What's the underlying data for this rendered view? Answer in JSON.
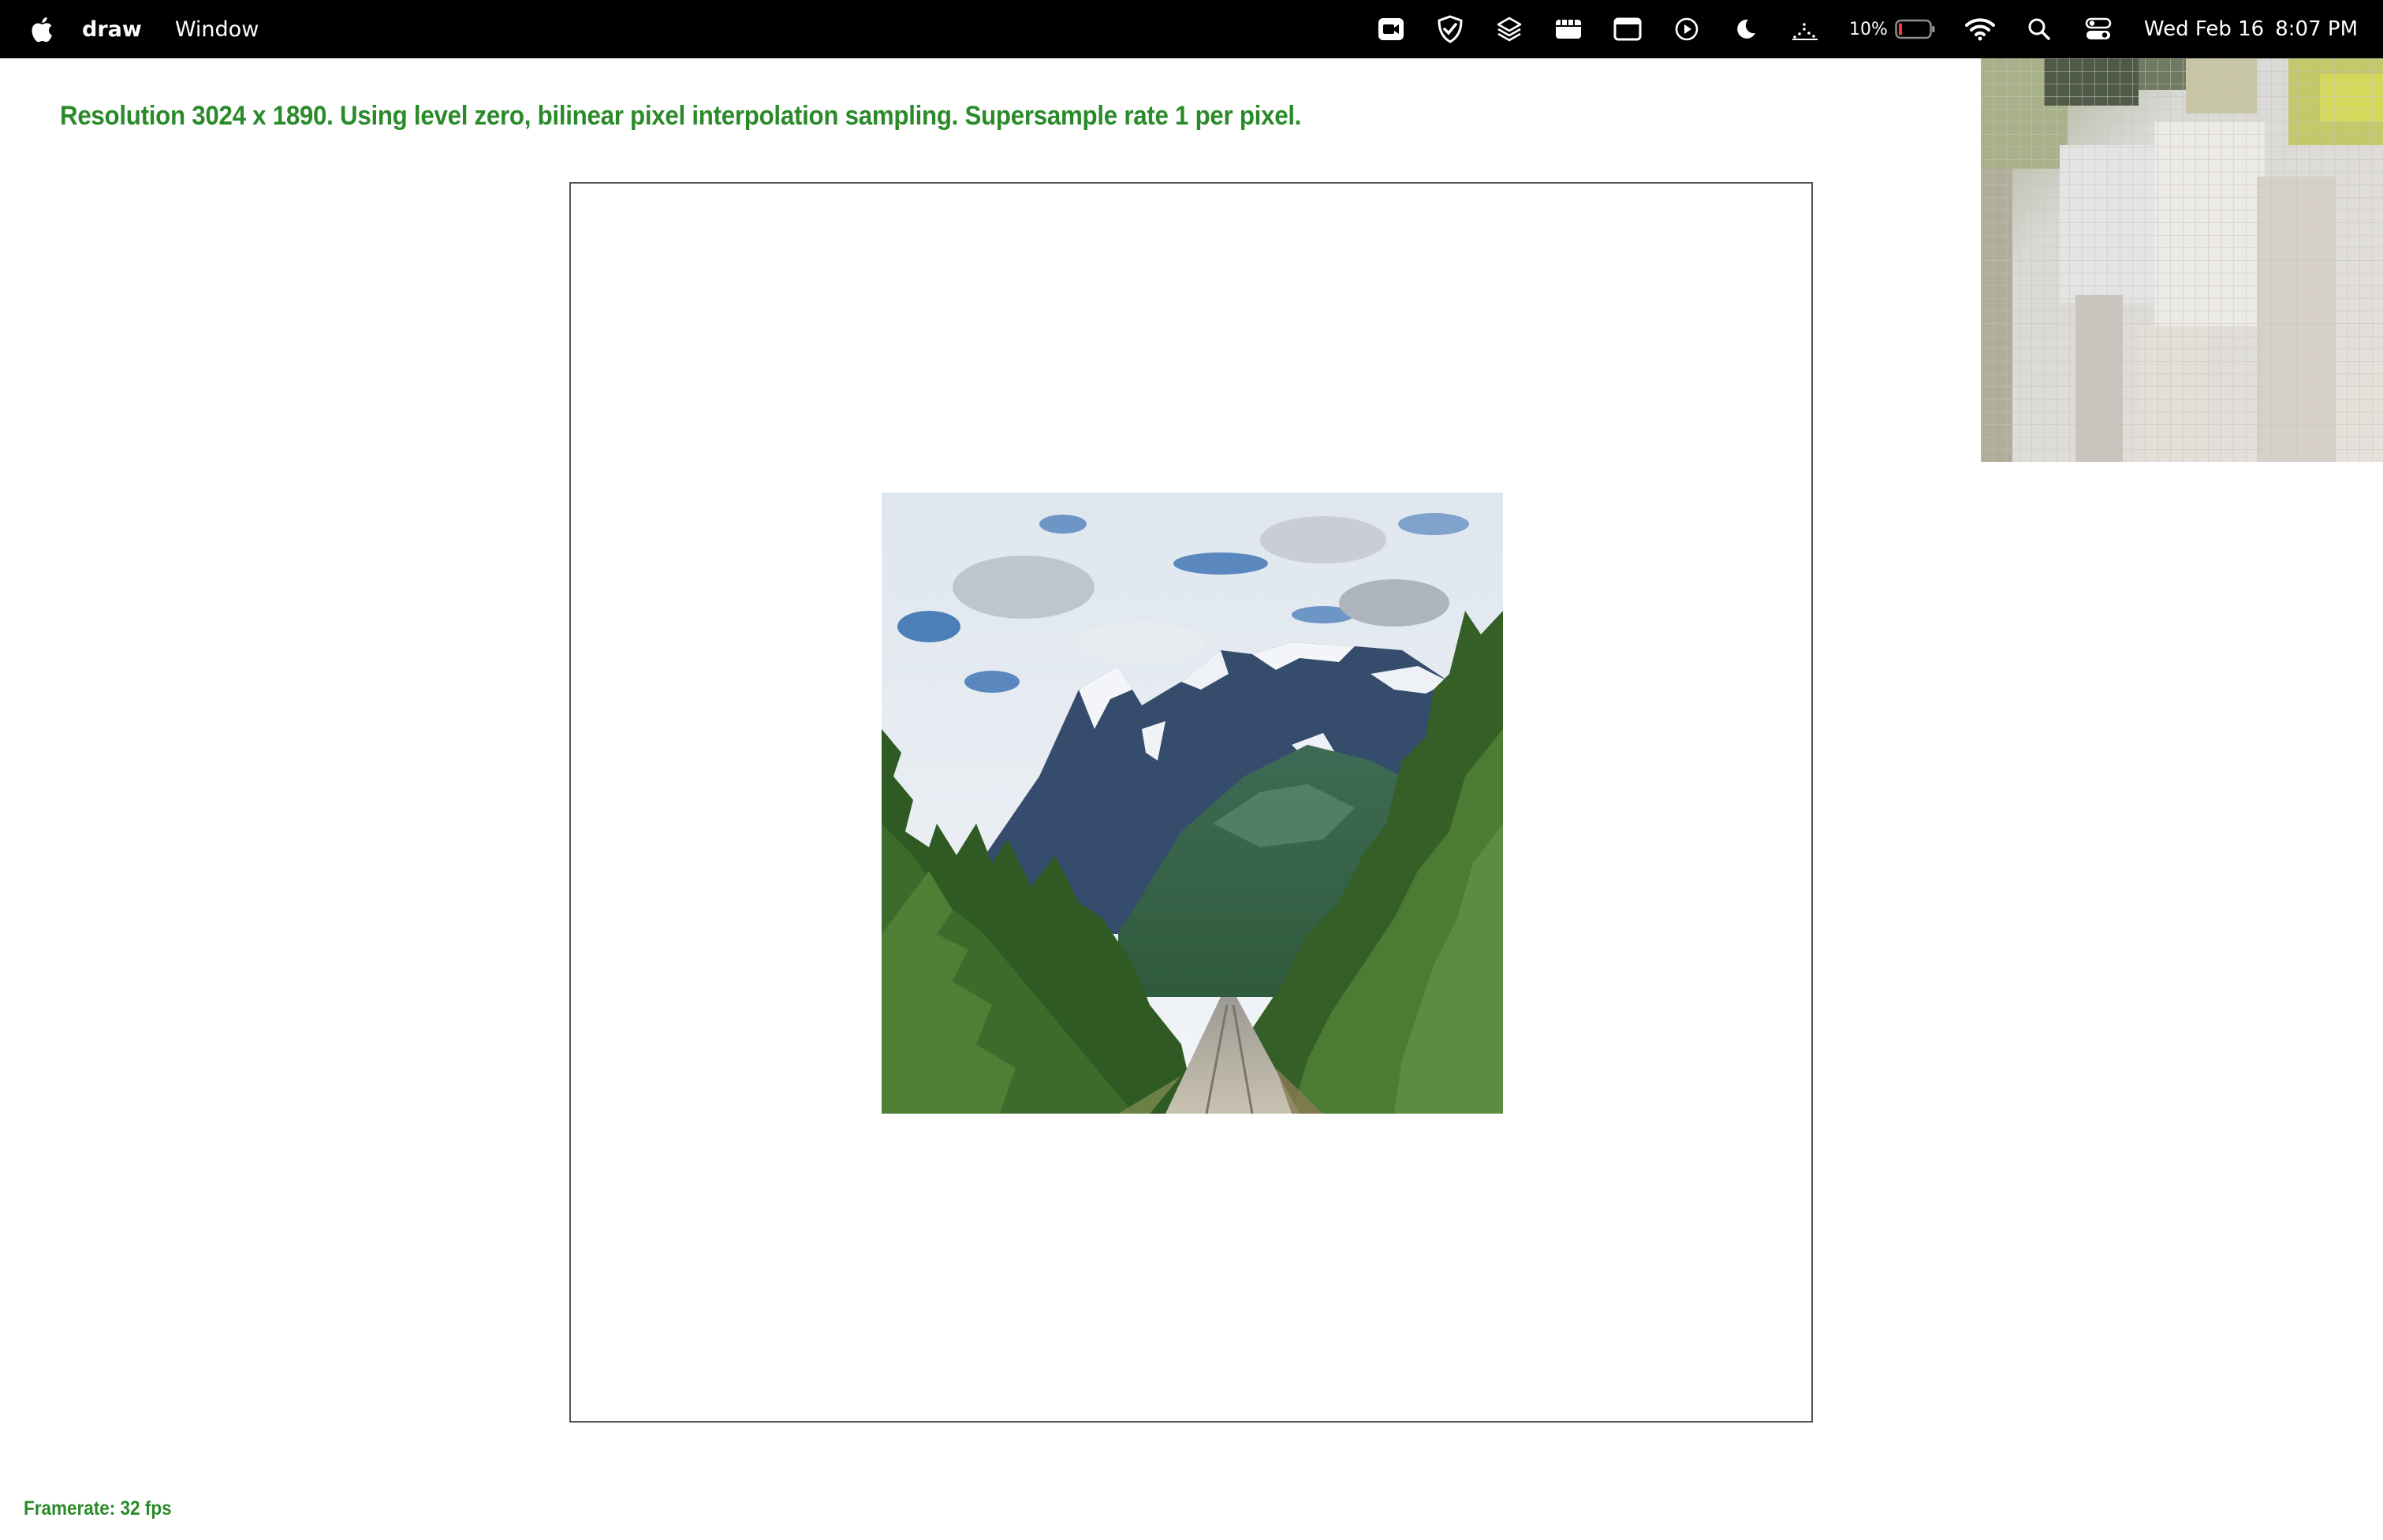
{
  "menubar": {
    "app_name": "draw",
    "menu_items": [
      "Window"
    ],
    "battery_percent": "10%",
    "date": "Wed Feb 16",
    "time": "8:07 PM",
    "status_icons": [
      "video-camera-icon",
      "shield-check-icon",
      "layers-icon",
      "media-strip-icon",
      "window-icon",
      "play-circle-icon",
      "moon-icon",
      "activity-icon",
      "battery-icon",
      "wifi-icon",
      "search-icon",
      "control-center-icon"
    ]
  },
  "app": {
    "status_text": "Resolution 3024 x 1890. Using level zero, bilinear pixel interpolation sampling. Supersample rate 1 per pixel.",
    "framerate_text": "Framerate: 32 fps",
    "accent_color": "#2a8a2a"
  },
  "picture": {
    "subject": "mountain landscape with railway track through pine forest"
  }
}
